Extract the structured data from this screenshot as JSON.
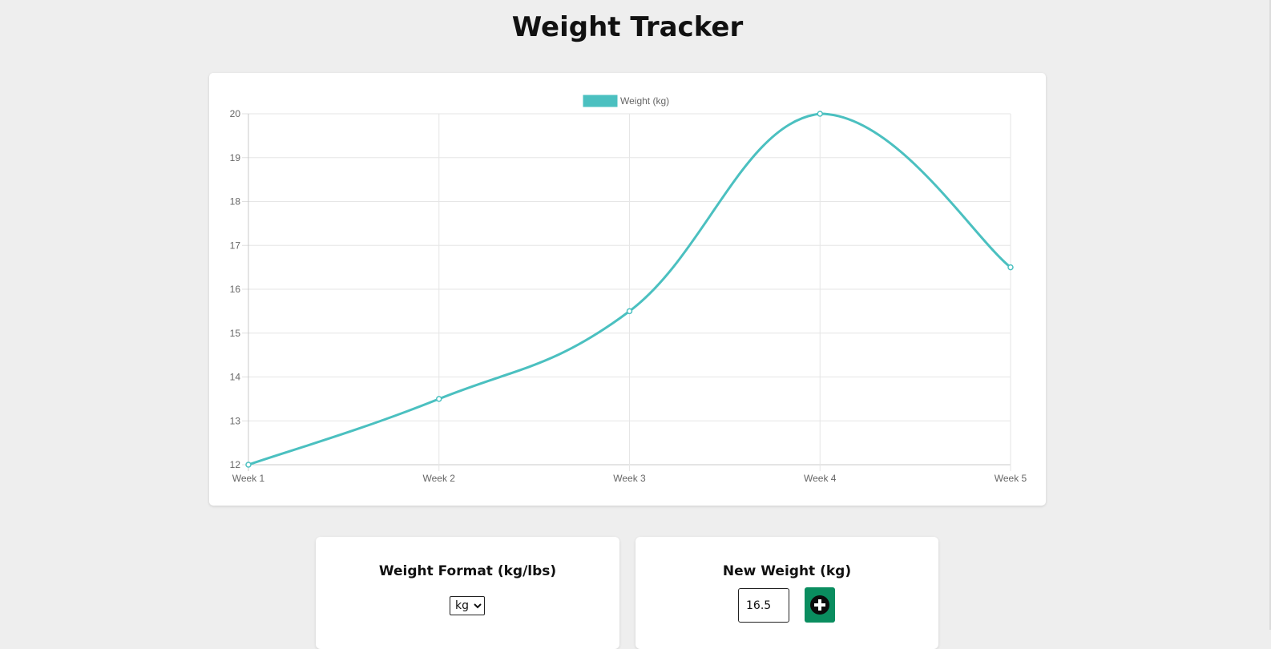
{
  "page": {
    "title": "Weight Tracker"
  },
  "chart_data": {
    "type": "line",
    "categories": [
      "Week 1",
      "Week 2",
      "Week 3",
      "Week 4",
      "Week 5"
    ],
    "series": [
      {
        "name": "Weight (kg)",
        "values": [
          12,
          13.5,
          15.5,
          20,
          16.5
        ]
      }
    ],
    "ylim": [
      12,
      20
    ],
    "yticks": [
      "12",
      "13",
      "14",
      "15",
      "16",
      "17",
      "18",
      "19",
      "20"
    ],
    "grid": true,
    "legend": "top-center",
    "line_color": "#4bc0c0"
  },
  "format_panel": {
    "heading": "Weight Format (kg/lbs)",
    "selected": "kg"
  },
  "new_weight_panel": {
    "heading": "New Weight (kg)",
    "value": "16.5",
    "add_icon": "plus-circle-icon",
    "button_color": "#0a8d5f"
  }
}
